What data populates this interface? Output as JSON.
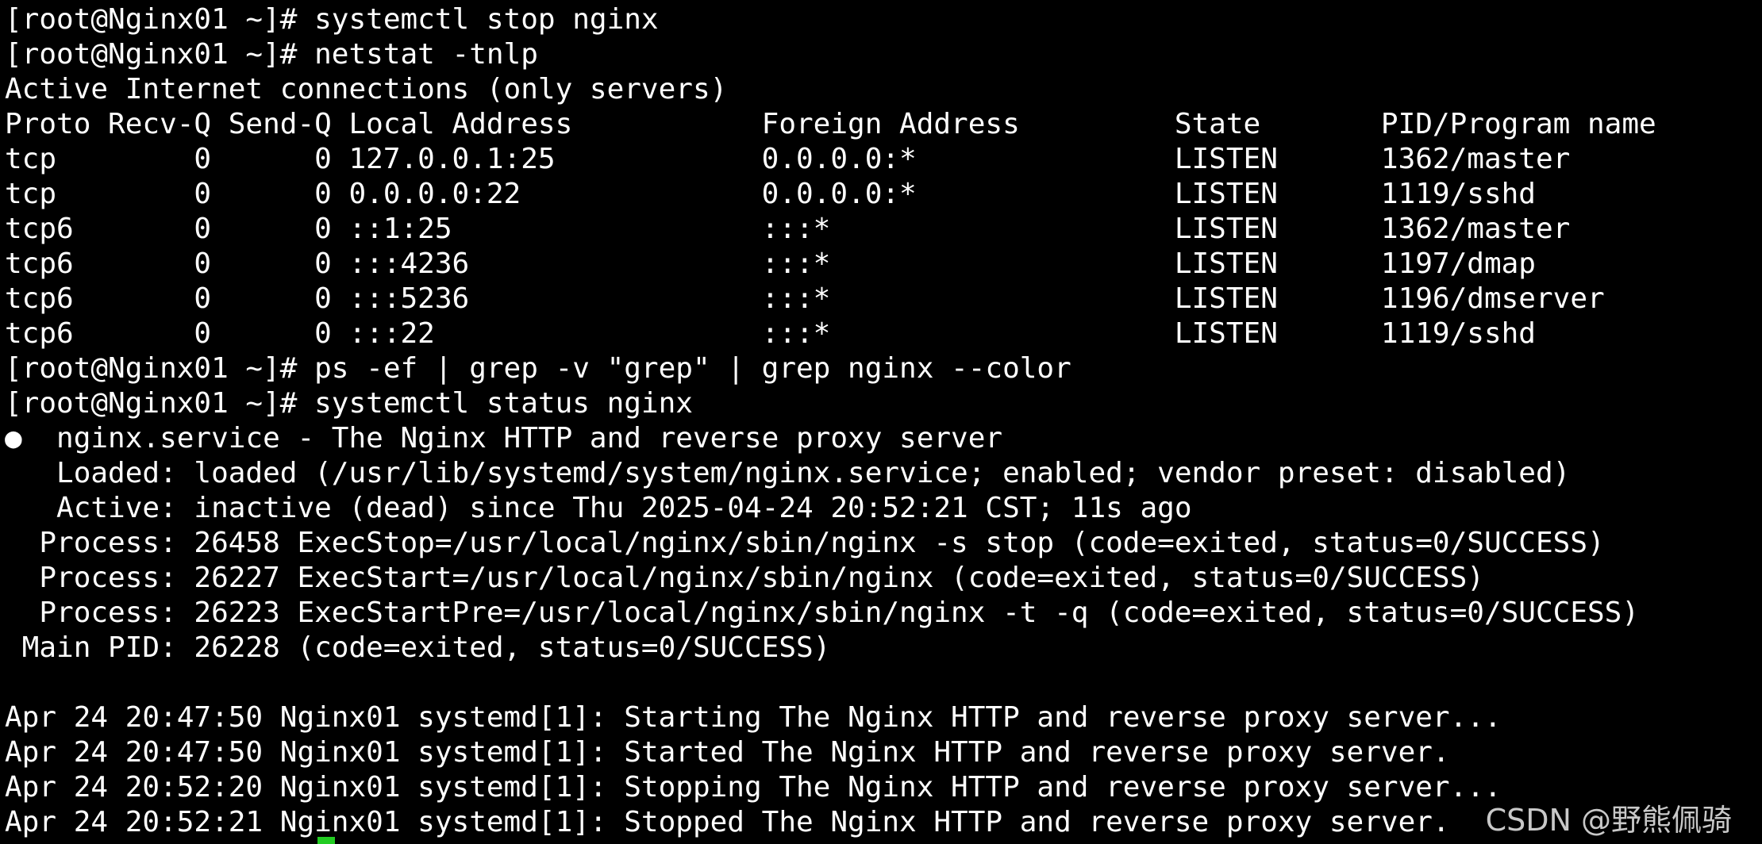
{
  "terminal": {
    "lines": [
      "[root@Nginx01 ~]# systemctl stop nginx",
      "[root@Nginx01 ~]# netstat -tnlp",
      "Active Internet connections (only servers)",
      "Proto Recv-Q Send-Q Local Address           Foreign Address         State       PID/Program name",
      "tcp        0      0 127.0.0.1:25            0.0.0.0:*               LISTEN      1362/master",
      "tcp        0      0 0.0.0.0:22              0.0.0.0:*               LISTEN      1119/sshd",
      "tcp6       0      0 ::1:25                  :::*                    LISTEN      1362/master",
      "tcp6       0      0 :::4236                 :::*                    LISTEN      1197/dmap",
      "tcp6       0      0 :::5236                 :::*                    LISTEN      1196/dmserver",
      "tcp6       0      0 :::22                   :::*                    LISTEN      1119/sshd",
      "[root@Nginx01 ~]# ps -ef | grep -v \"grep\" | grep nginx --color",
      "[root@Nginx01 ~]# systemctl status nginx",
      "●  nginx.service - The Nginx HTTP and reverse proxy server",
      "   Loaded: loaded (/usr/lib/systemd/system/nginx.service; enabled; vendor preset: disabled)",
      "   Active: inactive (dead) since Thu 2025-04-24 20:52:21 CST; 11s ago",
      "  Process: 26458 ExecStop=/usr/local/nginx/sbin/nginx -s stop (code=exited, status=0/SUCCESS)",
      "  Process: 26227 ExecStart=/usr/local/nginx/sbin/nginx (code=exited, status=0/SUCCESS)",
      "  Process: 26223 ExecStartPre=/usr/local/nginx/sbin/nginx -t -q (code=exited, status=0/SUCCESS)",
      " Main PID: 26228 (code=exited, status=0/SUCCESS)",
      "",
      "Apr 24 20:47:50 Nginx01 systemd[1]: Starting The Nginx HTTP and reverse proxy server...",
      "Apr 24 20:47:50 Nginx01 systemd[1]: Started The Nginx HTTP and reverse proxy server.",
      "Apr 24 20:52:20 Nginx01 systemd[1]: Stopping The Nginx HTTP and reverse proxy server...",
      "Apr 24 20:52:21 Nginx01 systemd[1]: Stopped The Nginx HTTP and reverse proxy server."
    ],
    "cursor_color": "#22cc22",
    "background_color": "#000000",
    "text_color": "#ffffff"
  },
  "watermark": {
    "text": "CSDN @野熊佩骑"
  }
}
